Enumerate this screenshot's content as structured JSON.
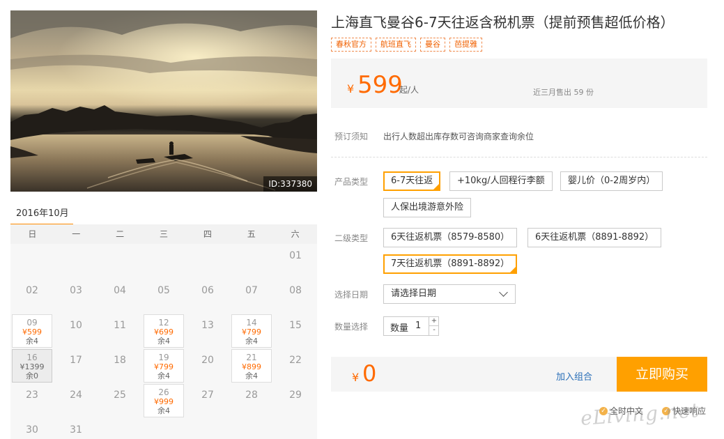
{
  "hero": {
    "id_label": "ID:337380"
  },
  "calendar": {
    "month_label": "2016年10月",
    "weekdays": [
      "日",
      "一",
      "二",
      "三",
      "四",
      "五",
      "六"
    ],
    "days": [
      {
        "day": "01"
      },
      {
        "day": "02"
      },
      {
        "day": "03"
      },
      {
        "day": "04"
      },
      {
        "day": "05"
      },
      {
        "day": "06"
      },
      {
        "day": "07"
      },
      {
        "day": "08"
      },
      {
        "day": "09",
        "price": "¥599",
        "stock": "余4"
      },
      {
        "day": "10"
      },
      {
        "day": "11"
      },
      {
        "day": "12",
        "price": "¥699",
        "stock": "余4"
      },
      {
        "day": "13"
      },
      {
        "day": "14",
        "price": "¥799",
        "stock": "余4"
      },
      {
        "day": "15"
      },
      {
        "day": "16",
        "price": "¥1399",
        "stock": "余0",
        "soldout": true
      },
      {
        "day": "17"
      },
      {
        "day": "18"
      },
      {
        "day": "19",
        "price": "¥799",
        "stock": "余4"
      },
      {
        "day": "20"
      },
      {
        "day": "21",
        "price": "¥899",
        "stock": "余4"
      },
      {
        "day": "22"
      },
      {
        "day": "23"
      },
      {
        "day": "24"
      },
      {
        "day": "25"
      },
      {
        "day": "26",
        "price": "¥999",
        "stock": "余4"
      },
      {
        "day": "27"
      },
      {
        "day": "28"
      },
      {
        "day": "29"
      },
      {
        "day": "30"
      },
      {
        "day": "31"
      }
    ]
  },
  "product": {
    "title": "上海直飞曼谷6-7天往返含税机票（提前预售超低价格）",
    "tags": [
      "春秋官方",
      "航班直飞",
      "曼谷",
      "芭提雅"
    ],
    "price": {
      "currency": "¥",
      "amount": "599",
      "unit": "起/人",
      "sold": "近三月售出 59 份"
    },
    "notice": {
      "label": "预订须知",
      "text": "出行人数超出库存数可咨询商家查询余位"
    },
    "product_type": {
      "label": "产品类型",
      "options": [
        "6-7天往返",
        "+10kg/人回程行李额",
        "婴儿价（0-2周岁内）",
        "人保出境游意外险"
      ],
      "selected_index": 0
    },
    "sub_type": {
      "label": "二级类型",
      "options": [
        "6天往返机票（8579-8580）",
        "6天往返机票（8891-8892）",
        "7天往返机票（8891-8892）"
      ],
      "selected_index": 2
    },
    "date": {
      "label": "选择日期",
      "value": "请选择日期"
    },
    "quantity": {
      "label": "数量选择",
      "field_label": "数量",
      "value": "1",
      "plus": "+",
      "minus": "-"
    },
    "buy": {
      "currency": "¥",
      "total": "0",
      "combo_label": "加入组合",
      "button_label": "立即购买"
    },
    "guarantees": [
      "全时中文",
      "快速响应"
    ]
  },
  "watermark": "eLiving.net",
  "colors": {
    "accent": "#ffa000",
    "price": "#ff6a00",
    "link": "#2a6fb8"
  }
}
